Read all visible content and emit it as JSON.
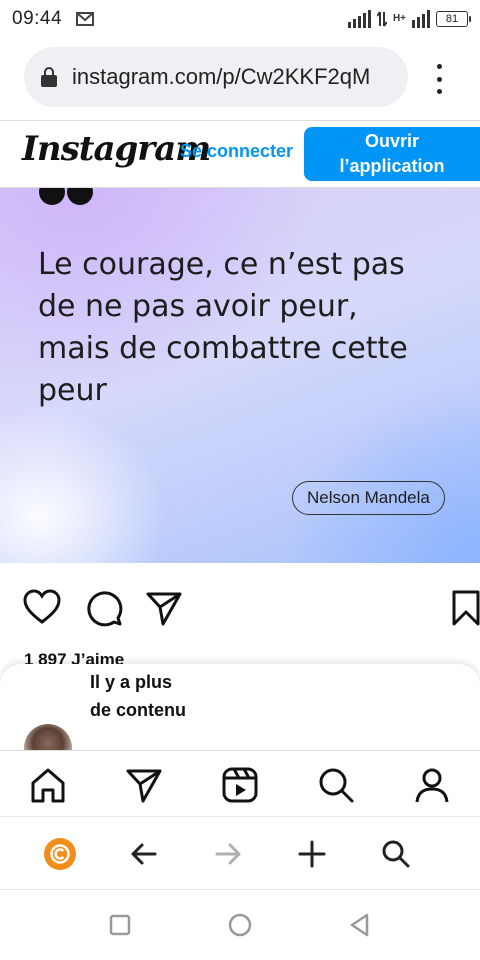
{
  "status_bar": {
    "time": "09:44",
    "network_label": "H+",
    "battery": "81"
  },
  "browser": {
    "url": "instagram.com/p/Cw2KKF2qM"
  },
  "ig_header": {
    "logo": "Instagram",
    "login_label": "Se connecter",
    "open_app_label_line1": "Ouvrir",
    "open_app_label_line2": "l’application",
    "accent_color": "#0095f6"
  },
  "post": {
    "quote": "Le courage, ce n’est pas de ne pas avoir peur, mais de combattre cette peur",
    "author": "Nelson Mandela",
    "likes": "1 897 J’aime"
  },
  "sheet": {
    "text": "Il y a plus de contenu"
  },
  "ig_nav": {
    "items": [
      "home-icon",
      "send-icon",
      "reels-icon",
      "search-icon",
      "profile-icon"
    ]
  },
  "browser_bar": {
    "items": [
      "browser-logo-icon",
      "back-arrow-icon",
      "forward-arrow-icon",
      "new-tab-icon",
      "search-icon"
    ]
  },
  "android_nav": {
    "items": [
      "recents-icon",
      "home-circle-icon",
      "back-triangle-icon"
    ]
  }
}
